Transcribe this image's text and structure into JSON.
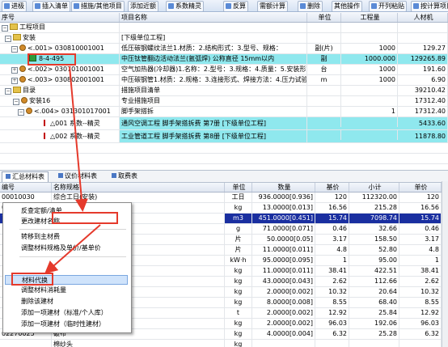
{
  "toolbar": {
    "buttons": [
      "进极",
      "插入清单",
      "措施/其他项目",
      "添加近额",
      "系数精灵",
      "反算",
      "需额计算",
      "删除",
      "其他操作",
      "开列粘贴",
      "按计算项目"
    ]
  },
  "top_grid": {
    "columns": [
      "序号",
      "项目名称",
      "单位",
      "工程量",
      "人材机"
    ],
    "rows": [
      {
        "seq": "工程项目",
        "name": "",
        "unit": "",
        "qty": "",
        "price": ""
      },
      {
        "seq": "安装",
        "name": "[下级单位工程]",
        "unit": "",
        "qty": "",
        "price": ""
      },
      {
        "seq": "<.001> 030810001001",
        "name": "低压碳钢螺纹法兰1.材质：2.结构形式：3.型号、规格：",
        "unit": "副(片)",
        "qty": "1000",
        "price": "129.27"
      },
      {
        "seq": "8-4-495",
        "name": "中压钛管翻边活动法兰(氩弧焊) 公称直径 15mm以内",
        "unit": "副",
        "qty": "1000.000",
        "price": "129265.89"
      },
      {
        "seq": "<.002> 030701001001",
        "name": "空气加热器(冷却器)1.名称：2.型号：3.规格：4.质量：5.安装形式：6.",
        "unit": "台",
        "qty": "1000",
        "price": "191.60"
      },
      {
        "seq": "<.003> 030802001001",
        "name": "中压碳钢管1.材质：2.规格：3.连接形式、焊接方法：4.压力试验、吹",
        "unit": "m",
        "qty": "1000",
        "price": "6.90"
      },
      {
        "seq": "目录",
        "name": "措施项目清单",
        "unit": "",
        "qty": "",
        "price": "39210.42"
      },
      {
        "seq": "安装16",
        "name": "专业措施项目",
        "unit": "",
        "qty": "",
        "price": "17312.40"
      },
      {
        "seq": "<.004> 031301017001",
        "name": "脚手架搭拆",
        "unit": "",
        "qty": "1",
        "price": "17312.40"
      },
      {
        "seq": "△001  系数--精灵",
        "name": "通风空调工程 脚手架搭拆费 第7册 [下级单位工程]",
        "unit": "",
        "qty": "",
        "price": "5433.60"
      },
      {
        "seq": "△002  系数--精灵",
        "name": "工业管道工程 脚手架搭拆费 第8册 [下级单位工程]",
        "unit": "",
        "qty": "",
        "price": "11878.80"
      }
    ]
  },
  "tabs": [
    "汇总材料表",
    "议价材料表",
    "取费表"
  ],
  "bottom_grid": {
    "columns": [
      "编号",
      "名称规格",
      "单位",
      "数量",
      "基价",
      "小计",
      "单价"
    ],
    "rows": [
      {
        "code": "00010030",
        "name": "综合工日(安装)",
        "unit": "工日",
        "qty": "936.0000[0.936]",
        "base": "120",
        "sub": "112320.00",
        "price": "120"
      },
      {
        "code": "03130357",
        "name": "钛氩弧焊丝",
        "unit": "kg",
        "qty": "13.0000[0.013]",
        "base": "16.56",
        "sub": "215.28",
        "price": "16.56"
      },
      {
        "code": "14390037",
        "name": "氩气 99.999%",
        "unit": "m3",
        "qty": "451.0000[0.451]",
        "base": "15.74",
        "sub": "7098.74",
        "price": "15.74"
      },
      {
        "code": "",
        "name": "",
        "unit": "g",
        "qty": "71.0000[0.071]",
        "base": "0.46",
        "sub": "32.66",
        "price": "0.46"
      },
      {
        "code": "",
        "name": "",
        "unit": "片",
        "qty": "50.0000[0.05]",
        "base": "3.17",
        "sub": "158.50",
        "price": "3.17"
      },
      {
        "code": "",
        "name": "",
        "unit": "片",
        "qty": "11.0000[0.011]",
        "base": "4.8",
        "sub": "52.80",
        "price": "4.8"
      },
      {
        "code": "",
        "name": "",
        "unit": "kW·h",
        "qty": "95.0000[0.095]",
        "base": "1",
        "sub": "95.00",
        "price": "1"
      },
      {
        "code": "",
        "name": "",
        "unit": "kg",
        "qty": "11.0000[0.011]",
        "base": "38.41",
        "sub": "422.51",
        "price": "38.41"
      },
      {
        "code": "",
        "name": "",
        "unit": "kg",
        "qty": "43.0000[0.043]",
        "base": "2.62",
        "sub": "112.66",
        "price": "2.62"
      },
      {
        "code": "",
        "name": "",
        "unit": "kg",
        "qty": "2.0000[0.002]",
        "base": "10.32",
        "sub": "20.64",
        "price": "10.32"
      },
      {
        "code": "",
        "name": "",
        "unit": "kg",
        "qty": "8.0000[0.008]",
        "base": "8.55",
        "sub": "68.40",
        "price": "8.55"
      },
      {
        "code": "",
        "name": "",
        "unit": "t",
        "qty": "2.0000[0.002]",
        "base": "12.92",
        "sub": "25.84",
        "price": "12.92"
      },
      {
        "code": "",
        "name": "",
        "unit": "kg",
        "qty": "2.0000[0.002]",
        "base": "96.03",
        "sub": "192.06",
        "price": "96.03"
      },
      {
        "code": "02270025",
        "name": "破布",
        "unit": "kg",
        "qty": "4.0000[0.004]",
        "base": "6.32",
        "sub": "25.28",
        "price": "6.32"
      },
      {
        "code": "",
        "name": "棉纱头",
        "unit": "kg",
        "qty": "",
        "base": "",
        "sub": "",
        "price": ""
      }
    ]
  },
  "context_menu": {
    "items": [
      "反查定额/清单",
      "更改建材名称",
      "转移到主材费",
      "调整材料规格及单价/基单价",
      "材料代换",
      "调整材料消耗量",
      "删除该建材",
      "添加一项建材（标准/个人库）",
      "添加一项建材（临时性建材）"
    ],
    "highlighted": "材料代换"
  },
  "colors": {
    "annotation_red": "#e53a2c",
    "selection_blue": "#1a2fa0",
    "cyan_row": "#8fe8ee"
  }
}
